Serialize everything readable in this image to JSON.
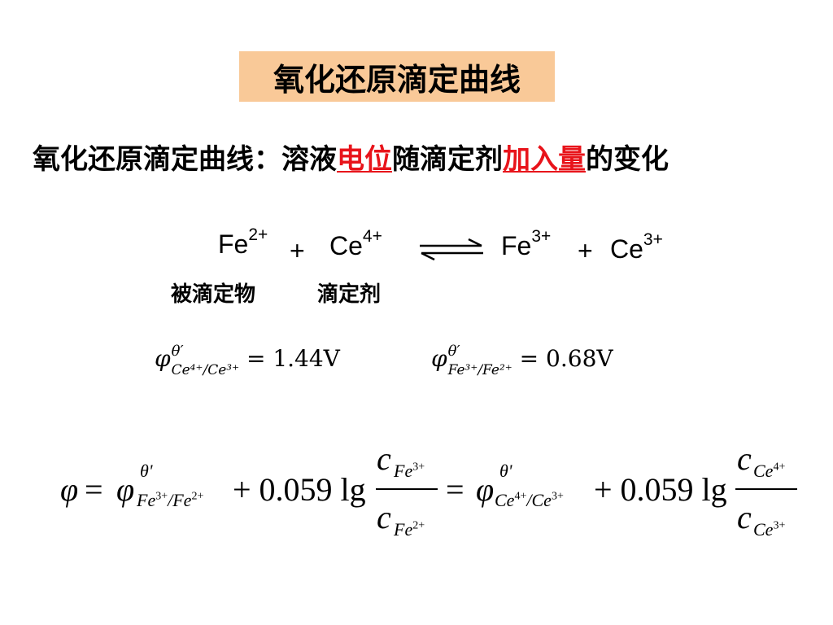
{
  "title": "氧化还原滴定曲线",
  "subtitle": {
    "prefix": "氧化还原滴定曲线：溶液",
    "hl1": "电位",
    "mid": "随滴定剂",
    "hl2": "加入量",
    "suffix": "的变化"
  },
  "reaction": {
    "r1": "Fe",
    "r1_charge": "2+",
    "plus1": "+",
    "r2": "Ce",
    "r2_charge": "4+",
    "p1": "Fe",
    "p1_charge": "3+",
    "plus2": "+",
    "p2": "Ce",
    "p2_charge": "3+",
    "label_analyte": "被滴定物",
    "label_titrant": "滴定剂"
  },
  "potentials": {
    "phi": "φ",
    "theta": "θ′",
    "ce_sub": "Ce⁴⁺/Ce³⁺",
    "ce_value": "= 1.44V",
    "fe_sub": "Fe³⁺/Fe²⁺",
    "fe_value": "= 0.68V"
  },
  "nernst": {
    "phi": "φ",
    "eq": "=",
    "theta": "θ'",
    "fe_sub": "Fe",
    "fe_sub_c1": "3+",
    "fe_sub_c2": "2+",
    "ce_sub": "Ce",
    "ce_sub_c1": "4+",
    "ce_sub_c2": "3+",
    "term": "+ 0.059 lg",
    "c": "c",
    "num1_sp": "Fe",
    "num1_charge": "3+",
    "den1_sp": "Fe",
    "den1_charge": "2+",
    "num2_sp": "Ce",
    "num2_charge": "4+",
    "den2_sp": "Ce",
    "den2_charge": "3+"
  }
}
